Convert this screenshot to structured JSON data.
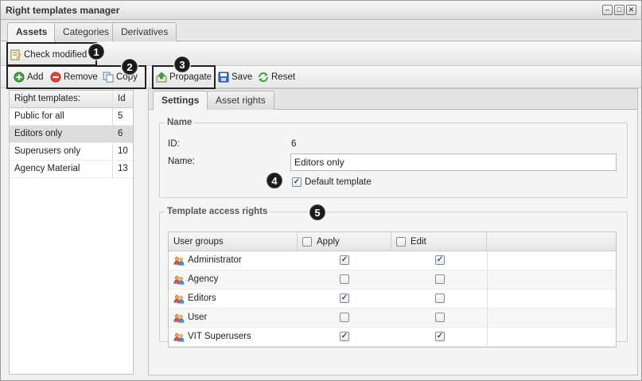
{
  "window": {
    "title": "Right templates manager",
    "buttons": [
      "–",
      "□",
      "✕"
    ]
  },
  "top_tabs": [
    "Assets",
    "Categories",
    "Derivatives"
  ],
  "toolbar1": {
    "check_modified": "Check modified"
  },
  "toolbar2": {
    "add": "Add",
    "remove": "Remove",
    "copy": "Copy"
  },
  "toolbar3": {
    "propagate": "Propagate",
    "save": "Save",
    "reset": "Reset"
  },
  "templates": {
    "headers": [
      "Right templates:",
      "Id"
    ],
    "rows": [
      {
        "name": "Public for all",
        "id": "5"
      },
      {
        "name": "Editors only",
        "id": "6",
        "selected": true
      },
      {
        "name": "Superusers only",
        "id": "10"
      },
      {
        "name": "Agency Material",
        "id": "13"
      }
    ]
  },
  "inner_tabs": [
    "Settings",
    "Asset rights"
  ],
  "name_section": {
    "legend": "Name",
    "id_label": "ID:",
    "id_value": "6",
    "name_label": "Name:",
    "name_value": "Editors only",
    "default_label": "Default template",
    "default_checked": true
  },
  "access_section": {
    "legend": "Template access rights",
    "headers": {
      "groups": "User groups",
      "apply": "Apply",
      "edit": "Edit"
    },
    "rows": [
      {
        "group": "Administrator",
        "apply": true,
        "edit": true
      },
      {
        "group": "Agency",
        "apply": false,
        "edit": false
      },
      {
        "group": "Editors",
        "apply": true,
        "edit": false
      },
      {
        "group": "User",
        "apply": false,
        "edit": false
      },
      {
        "group": "VIT Superusers",
        "apply": true,
        "edit": true
      }
    ]
  },
  "callouts": [
    "1",
    "2",
    "3",
    "4",
    "5"
  ],
  "colors": {
    "callout": "#1a1a1a",
    "checkmark": "#1d4f9f",
    "selected_row": "#dcdcdc"
  }
}
